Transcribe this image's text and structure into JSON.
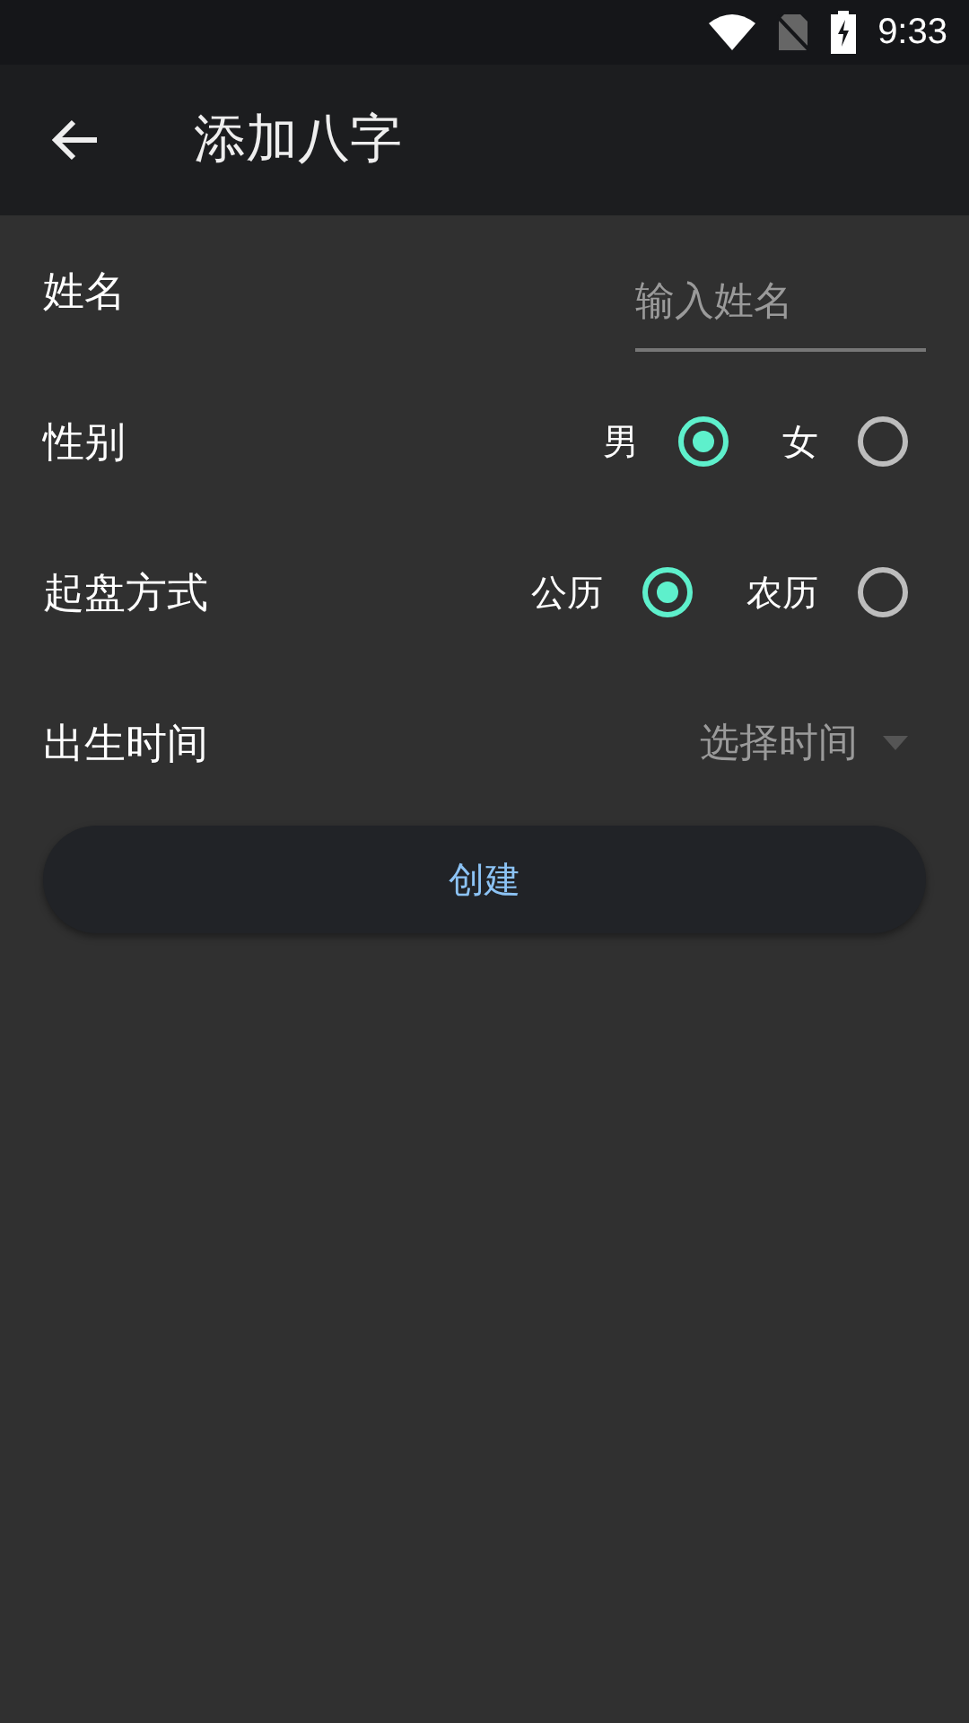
{
  "status_bar": {
    "time": "9:33"
  },
  "app_bar": {
    "title": "添加八字"
  },
  "rows": [
    {
      "kind": "text",
      "label": "姓名",
      "placeholder": "输入姓名"
    },
    {
      "kind": "radio",
      "label": "性别",
      "options": [
        {
          "label": "男",
          "selected": true
        },
        {
          "label": "女",
          "selected": false
        }
      ]
    },
    {
      "kind": "radio",
      "label": "起盘方式",
      "options": [
        {
          "label": "公历",
          "selected": true
        },
        {
          "label": "农历",
          "selected": false
        }
      ]
    },
    {
      "kind": "select",
      "label": "出生时间",
      "placeholder": "选择时间"
    }
  ],
  "button": {
    "label": "创建"
  }
}
